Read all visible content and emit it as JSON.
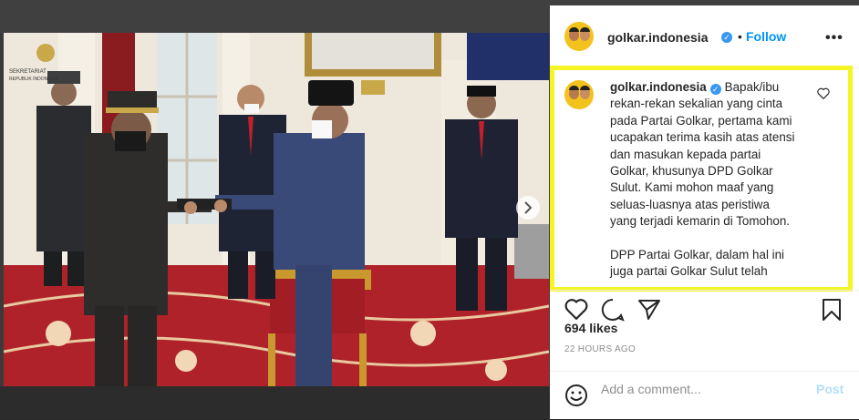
{
  "post": {
    "username": "golkar.indonesia",
    "follow_label": "Follow",
    "dot": "•",
    "more_label": "•••",
    "caption_lines": [
      "Bapak/ibu",
      "rekan-rekan sekalian yang cinta",
      "pada Partai Golkar, pertama kami",
      "ucapakan terima kasih atas atensi",
      "dan masukan kepada partai",
      "Golkar, khusunya DPD Golkar",
      "Sulut. Kami mohon maaf yang",
      "seluas-luasnya atas peristiwa",
      "yang terjadi kemarin di Tomohon.",
      "",
      "DPP Partai Golkar, dalam hal ini",
      "juga partai Golkar Sulut telah"
    ],
    "likes": "694 likes",
    "timestamp": "22 HOURS AGO",
    "comment_placeholder": "Add a comment...",
    "post_label": "Post"
  },
  "photo": {
    "watermark_line1": "SEKRETARIAT",
    "watermark_line2": "REPUBLIK INDONESIA",
    "carousel_dots": 7,
    "active_dot": 0
  },
  "colors": {
    "accent": "#0095f6",
    "highlight": "#f5f525",
    "carpet": "#b0222a",
    "verified": "#3897f0"
  },
  "icons": [
    "verified-icon",
    "heart-icon",
    "comment-icon",
    "share-icon",
    "bookmark-icon",
    "emoji-icon",
    "chevron-right-icon"
  ]
}
